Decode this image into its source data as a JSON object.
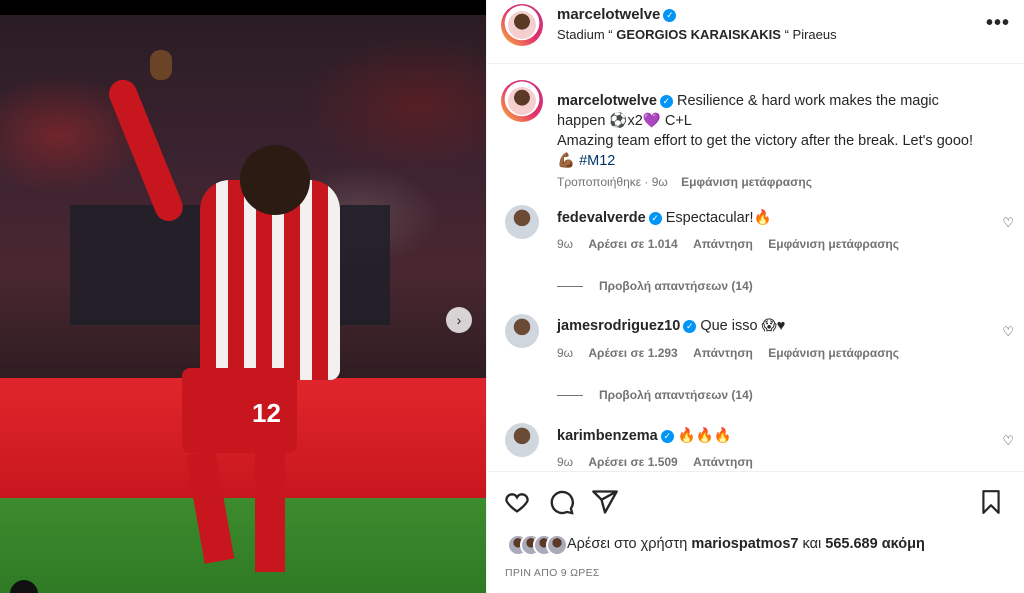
{
  "post": {
    "author": "marcelotwelve",
    "location_prefix": "Stadium “",
    "location_name": "GEORGIOS KARAISKAKIS",
    "location_suffix": "“ Piraeus",
    "more_label": "•••",
    "shorts_number": "12",
    "next_icon": "›"
  },
  "caption": {
    "author": "marcelotwelve",
    "text_line1": "Resilience & hard work makes the magic happen ⚽x2💜 C+L",
    "text_line2": "Amazing team effort to get the victory after the break. Let's gooo! 💪🏾",
    "hashtag": "#M12",
    "edited_label": "Τροποποιήθηκε · 9ω",
    "translate_label": "Εμφάνιση μετάφρασης"
  },
  "comments": [
    {
      "author": "fedevalverde",
      "text": "Espectacular!🔥",
      "time": "9ω",
      "likes": "Αρέσει σε 1.014",
      "reply": "Απάντηση",
      "translate": "Εμφάνιση μετάφρασης",
      "view_replies": "Προβολή απαντήσεων (14)"
    },
    {
      "author": "jamesrodriguez10",
      "text": "Que isso 😱♥",
      "time": "9ω",
      "likes": "Αρέσει σε 1.293",
      "reply": "Απάντηση",
      "translate": "Εμφάνιση μετάφρασης",
      "view_replies": "Προβολή απαντήσεων (14)"
    },
    {
      "author": "karimbenzema",
      "text": "🔥🔥🔥",
      "time": "9ω",
      "likes": "Αρέσει σε 1.509",
      "reply": "Απάντηση"
    }
  ],
  "actions": {
    "liked_by_prefix": "Αρέσει στο χρήστη",
    "liked_by_user": "mariospatmos7",
    "liked_by_and": "και",
    "liked_by_count": "565.689 ακόμη",
    "timestamp": "ΠΡΙΝ ΑΠΟ 9 ΩΡΕΣ"
  },
  "colors": {
    "verified": "#0095f6",
    "hashtag": "#00376b",
    "secondary_text": "#737373",
    "jersey_red": "#c8161e"
  }
}
